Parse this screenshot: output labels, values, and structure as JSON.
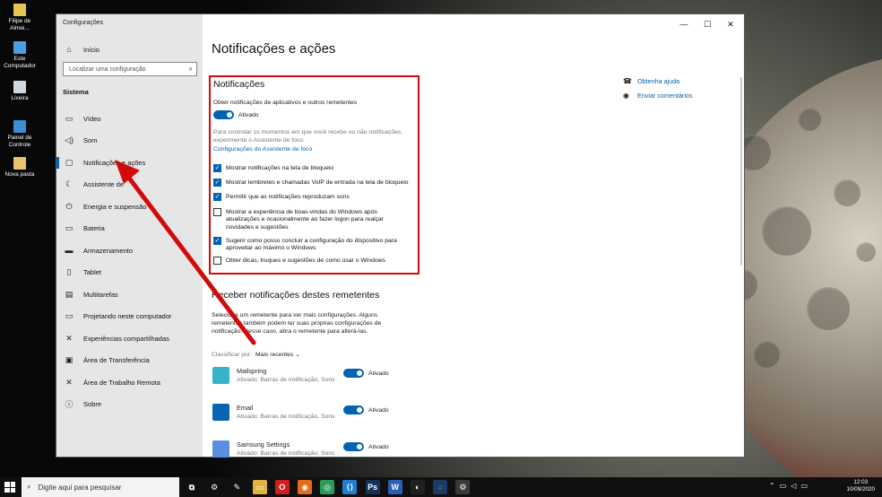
{
  "desktop_icons": [
    {
      "label": "Filipe de Almei...",
      "icon": "file-icon",
      "color": "#e8c552"
    },
    {
      "label": "Este Computador",
      "icon": "computer-icon",
      "color": "#4aa0e6"
    },
    {
      "label": "Lixeira",
      "icon": "recycle-bin-icon",
      "color": "#cfd8e0"
    },
    {
      "label": "Painel de Controle",
      "icon": "control-panel-icon",
      "color": "#3b8ed8"
    },
    {
      "label": "Nova pasta",
      "icon": "folder-icon",
      "color": "#e9c46a"
    }
  ],
  "window": {
    "app_title": "Configurações",
    "controls": {
      "minimize": "—",
      "maximize": "☐",
      "close": "✕"
    }
  },
  "sidebar": {
    "home": "Início",
    "search_placeholder": "Localizar uma configuração",
    "section": "Sistema",
    "items": [
      {
        "label": "Vídeo",
        "icon": "display-icon",
        "glyph": "▭"
      },
      {
        "label": "Som",
        "icon": "speaker-icon",
        "glyph": "◁)"
      },
      {
        "label": "Notificações e ações",
        "icon": "notification-icon",
        "glyph": "▢",
        "selected": true
      },
      {
        "label": "Assistente de",
        "icon": "moon-icon",
        "glyph": "☾"
      },
      {
        "label": "Energia e suspensão",
        "icon": "power-icon",
        "glyph": "⏻"
      },
      {
        "label": "Bateria",
        "icon": "battery-icon",
        "glyph": "▭"
      },
      {
        "label": "Armazenamento",
        "icon": "storage-icon",
        "glyph": "▬"
      },
      {
        "label": "Tablet",
        "icon": "tablet-icon",
        "glyph": "▯"
      },
      {
        "label": "Multitarefas",
        "icon": "multitask-icon",
        "glyph": "▤"
      },
      {
        "label": "Projetando neste computador",
        "icon": "project-icon",
        "glyph": "▭"
      },
      {
        "label": "Experiências compartilhadas",
        "icon": "shared-icon",
        "glyph": "✕"
      },
      {
        "label": "Área de Transferência",
        "icon": "clipboard-icon",
        "glyph": "▣"
      },
      {
        "label": "Área de Trabalho Remota",
        "icon": "remote-icon",
        "glyph": "✕"
      },
      {
        "label": "Sobre",
        "icon": "info-icon",
        "glyph": "ⓘ"
      }
    ]
  },
  "main": {
    "title": "Notificações e ações",
    "notifications": {
      "heading": "Notificações",
      "get_notifications_label": "Obter notificações de aplicativos e outros remetentes",
      "toggle_state": "Ativado",
      "focus_text_1": "Para controlar os momentos em que você recebe ou não notificações,",
      "focus_text_2": "experimente o Assistente de foco.",
      "focus_link": "Configurações do Assistente de foco",
      "checkboxes": [
        {
          "lines": [
            "Mostrar notificações na tela de bloqueio"
          ],
          "checked": true
        },
        {
          "lines": [
            "Mostrar lembretes e chamadas VoIP de entrada na tela de bloqueio"
          ],
          "checked": true
        },
        {
          "lines": [
            "Permitir que as notificações reproduzam sons"
          ],
          "checked": true
        },
        {
          "lines": [
            "Mostrar a experiência de boas-vindas do Windows após",
            "atualizações e ocasionalmente ao fazer logon para realçar",
            "novidades e sugestões"
          ],
          "checked": false
        },
        {
          "lines": [
            "Sugerir como posso concluir a configuração do dispositivo para",
            "aproveitar ao máximo o Windows"
          ],
          "checked": true
        },
        {
          "lines": [
            "Obter dicas, truques e sugestões de como usar o Windows"
          ],
          "checked": false
        }
      ]
    },
    "senders": {
      "heading": "Receber notificações destes remetentes",
      "desc_1": "Selecione um remetente para ver mais configurações. Alguns",
      "desc_2": "remetentes também podem ter suas próprias configurações de",
      "desc_3": "notificação. Nesse caso, abra o remetente para alterá-las.",
      "sort_label": "Classificar por:",
      "sort_value": "Mais recentes",
      "apps": [
        {
          "name": "Mailspring",
          "sub": "Ativado: Barras de notificação, Sons",
          "state": "Ativado",
          "color": "#36b3c9"
        },
        {
          "name": "Email",
          "sub": "Ativado: Barras de notificação, Sons",
          "state": "Ativado",
          "color": "#0a64b4"
        },
        {
          "name": "Samsung Settings",
          "sub": "Ativado: Barras de notificação, Sons",
          "state": "Ativado",
          "color": "#5a8fe0"
        }
      ]
    },
    "help_links": [
      {
        "label": "Obtenha ajuda",
        "icon": "help-icon"
      },
      {
        "label": "Enviar comentários",
        "icon": "feedback-icon"
      }
    ]
  },
  "taskbar": {
    "search_placeholder": "Digite aqui para pesquisar",
    "apps": [
      {
        "icon": "task-view-icon",
        "glyph": "⧉",
        "color": "#101010"
      },
      {
        "icon": "settings-icon",
        "glyph": "⚙",
        "color": "#101010"
      },
      {
        "icon": "dev-tool-icon",
        "glyph": "✎",
        "color": "#101010"
      },
      {
        "icon": "file-explorer-icon",
        "glyph": "▭",
        "color": "#e3b341"
      },
      {
        "icon": "opera-icon",
        "glyph": "O",
        "color": "#d01e1e"
      },
      {
        "icon": "firefox-icon",
        "glyph": "◉",
        "color": "#e66a1c"
      },
      {
        "icon": "chat-icon",
        "glyph": "◎",
        "color": "#2a9d5c"
      },
      {
        "icon": "vscode-icon",
        "glyph": "⟨⟩",
        "color": "#1f7fd4"
      },
      {
        "icon": "photoshop-icon",
        "glyph": "Ps",
        "color": "#12325a"
      },
      {
        "icon": "word-icon",
        "glyph": "W",
        "color": "#2b5fb4"
      },
      {
        "icon": "github-icon",
        "glyph": "◐",
        "color": "#202020"
      },
      {
        "icon": "steam-icon",
        "glyph": "◌",
        "color": "#1b3a66"
      },
      {
        "icon": "settings-active-icon",
        "glyph": "⚙",
        "color": "#3a3a3a"
      }
    ],
    "time": "12:03",
    "date": "10/09/2020"
  },
  "accent_color": "#0063b1",
  "highlight_color": "#d20a0a"
}
